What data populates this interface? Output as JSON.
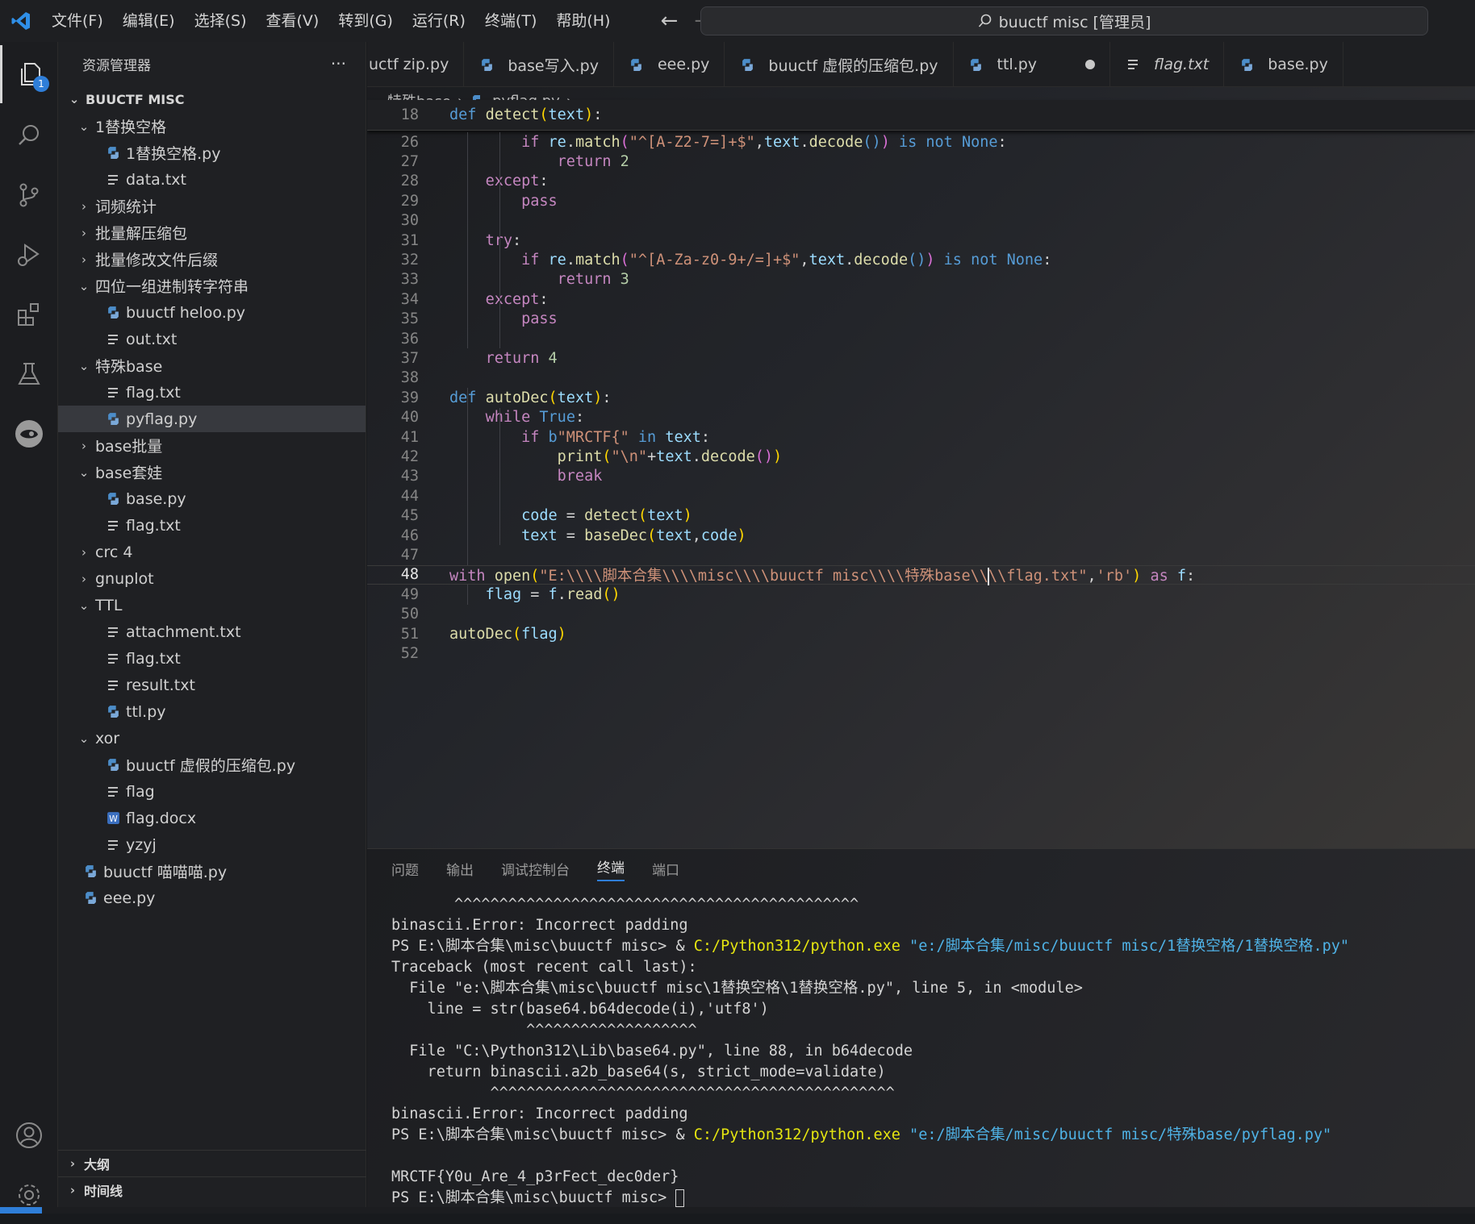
{
  "menu": [
    "文件(F)",
    "编辑(E)",
    "选择(S)",
    "查看(V)",
    "转到(G)",
    "运行(R)",
    "终端(T)",
    "帮助(H)"
  ],
  "nav": {
    "back": "←",
    "forward": "→"
  },
  "command_center": "buuctf misc [管理员]",
  "activity": {
    "explorer_badge": "1"
  },
  "sidebar": {
    "title": "资源管理器",
    "more": "···",
    "root": "BUUCTF MISC",
    "items": [
      {
        "label": "1替换空格",
        "type": "folder",
        "open": true,
        "depth": 1
      },
      {
        "label": "1替换空格.py",
        "type": "py",
        "depth": 2
      },
      {
        "label": "data.txt",
        "type": "txt",
        "depth": 2
      },
      {
        "label": "词频统计",
        "type": "folder",
        "open": false,
        "depth": 1
      },
      {
        "label": "批量解压缩包",
        "type": "folder",
        "open": false,
        "depth": 1
      },
      {
        "label": "批量修改文件后缀",
        "type": "folder",
        "open": false,
        "depth": 1
      },
      {
        "label": "四位一组进制转字符串",
        "type": "folder",
        "open": true,
        "depth": 1
      },
      {
        "label": "buuctf heloo.py",
        "type": "py",
        "depth": 2
      },
      {
        "label": "out.txt",
        "type": "txt",
        "depth": 2
      },
      {
        "label": "特殊base",
        "type": "folder",
        "open": true,
        "depth": 1
      },
      {
        "label": "flag.txt",
        "type": "txt",
        "depth": 2
      },
      {
        "label": "pyflag.py",
        "type": "py",
        "depth": 2,
        "selected": true
      },
      {
        "label": "base批量",
        "type": "folder",
        "open": false,
        "depth": 1
      },
      {
        "label": "base套娃",
        "type": "folder",
        "open": true,
        "depth": 1
      },
      {
        "label": "base.py",
        "type": "py",
        "depth": 2
      },
      {
        "label": "flag.txt",
        "type": "txt",
        "depth": 2
      },
      {
        "label": "crc 4",
        "type": "folder",
        "open": false,
        "depth": 1
      },
      {
        "label": "gnuplot",
        "type": "folder",
        "open": false,
        "depth": 1
      },
      {
        "label": "TTL",
        "type": "folder",
        "open": true,
        "depth": 1
      },
      {
        "label": "attachment.txt",
        "type": "txt",
        "depth": 2
      },
      {
        "label": "flag.txt",
        "type": "txt",
        "depth": 2
      },
      {
        "label": "result.txt",
        "type": "txt",
        "depth": 2
      },
      {
        "label": "ttl.py",
        "type": "py",
        "depth": 2
      },
      {
        "label": "xor",
        "type": "folder",
        "open": true,
        "depth": 1
      },
      {
        "label": "buuctf 虚假的压缩包.py",
        "type": "py",
        "depth": 2
      },
      {
        "label": "flag",
        "type": "txt",
        "depth": 2
      },
      {
        "label": "flag.docx",
        "type": "docx",
        "depth": 2
      },
      {
        "label": "yzyj",
        "type": "txt",
        "depth": 2
      },
      {
        "label": "buuctf 喵喵喵.py",
        "type": "py",
        "depth": 1
      },
      {
        "label": "eee.py",
        "type": "py",
        "depth": 1
      }
    ],
    "outline": "大纲",
    "timeline": "时间线"
  },
  "tabs": [
    {
      "label": "uctf zip.py",
      "icon": ""
    },
    {
      "label": "base写入.py",
      "icon": "py"
    },
    {
      "label": "eee.py",
      "icon": "py"
    },
    {
      "label": "buuctf 虚假的压缩包.py",
      "icon": "py"
    },
    {
      "label": "ttl.py",
      "icon": "py",
      "dirty": true
    },
    {
      "label": "flag.txt",
      "icon": "txt",
      "italic": true
    },
    {
      "label": "base.py",
      "icon": "py"
    }
  ],
  "breadcrumb": {
    "folder": "特殊base",
    "file": "pyflag.py",
    "more": "..."
  },
  "code": {
    "current_line": "48",
    "sticky": {
      "n": "18",
      "html": "<span class='k'>def</span> <span class='fn'>detect</span><span class='pb'>(</span><span class='var'>text</span><span class='pb'>)</span>:"
    },
    "lines": [
      {
        "n": "26",
        "html": "        <span class='kc'>if</span> <span class='var'>re</span>.<span class='fn'>match</span><span class='pu'>(</span><span class='str'>\"^[A-Z2-7=]+$\"</span>,<span class='var'>text</span>.<span class='fn'>decode</span><span class='k'>()</span><span class='pu'>)</span> <span class='k'>is</span> <span class='k'>not</span> <span class='k'>None</span>:"
      },
      {
        "n": "27",
        "html": "            <span class='kc'>return</span> <span class='num'>2</span>"
      },
      {
        "n": "28",
        "html": "    <span class='kc'>except</span>:"
      },
      {
        "n": "29",
        "html": "        <span class='kc'>pass</span>"
      },
      {
        "n": "30",
        "html": ""
      },
      {
        "n": "31",
        "html": "    <span class='kc'>try</span>:"
      },
      {
        "n": "32",
        "html": "        <span class='kc'>if</span> <span class='var'>re</span>.<span class='fn'>match</span><span class='pu'>(</span><span class='str'>\"^[A-Za-z0-9+/=]+$\"</span>,<span class='var'>text</span>.<span class='fn'>decode</span><span class='k'>()</span><span class='pu'>)</span> <span class='k'>is</span> <span class='k'>not</span> <span class='k'>None</span>:"
      },
      {
        "n": "33",
        "html": "            <span class='kc'>return</span> <span class='num'>3</span>"
      },
      {
        "n": "34",
        "html": "    <span class='kc'>except</span>:"
      },
      {
        "n": "35",
        "html": "        <span class='kc'>pass</span>"
      },
      {
        "n": "36",
        "html": ""
      },
      {
        "n": "37",
        "html": "    <span class='kc'>return</span> <span class='num'>4</span>"
      },
      {
        "n": "38",
        "html": ""
      },
      {
        "n": "39",
        "html": "<span class='k'>def</span> <span class='fn'>autoDec</span><span class='pb'>(</span><span class='var'>text</span><span class='pb'>)</span>:"
      },
      {
        "n": "40",
        "html": "    <span class='kc'>while</span> <span class='k'>True</span>:"
      },
      {
        "n": "41",
        "html": "        <span class='kc'>if</span> <span class='k'>b</span><span class='str'>\"MRCTF{\"</span> <span class='k'>in</span> <span class='var'>text</span>:"
      },
      {
        "n": "42",
        "html": "            <span class='fn'>print</span><span class='pb'>(</span><span class='str'>\"\\n\"</span>+<span class='var'>text</span>.<span class='fn'>decode</span><span class='pu'>()</span><span class='pb'>)</span>"
      },
      {
        "n": "43",
        "html": "            <span class='kc'>break</span>"
      },
      {
        "n": "44",
        "html": ""
      },
      {
        "n": "45",
        "html": "        <span class='var'>code</span> = <span class='fn'>detect</span><span class='pb'>(</span><span class='var'>text</span><span class='pb'>)</span>"
      },
      {
        "n": "46",
        "html": "        <span class='var'>text</span> = <span class='fn'>baseDec</span><span class='pb'>(</span><span class='var'>text</span>,<span class='var'>code</span><span class='pb'>)</span>"
      },
      {
        "n": "47",
        "html": ""
      },
      {
        "n": "48",
        "html": "<span class='kc'>with</span> <span class='fn'>open</span><span class='pb'>(</span><span class='str'>\"E:\\\\\\\\脚本合集\\\\\\\\misc\\\\\\\\buuctf misc\\\\\\\\特殊base\\\\<span class='cursor'></span>\\\\flag.txt\"</span>,<span class='str'>'rb'</span><span class='pb'>)</span> <span class='kc'>as</span> <span class='var'>f</span>:"
      },
      {
        "n": "49",
        "html": "    <span class='var'>flag</span> = <span class='var'>f</span>.<span class='fn'>read</span><span class='pb'>()</span>"
      },
      {
        "n": "50",
        "html": ""
      },
      {
        "n": "51",
        "html": "<span class='fn'>autoDec</span><span class='pb'>(</span><span class='var'>flag</span><span class='pb'>)</span>"
      },
      {
        "n": "52",
        "html": ""
      }
    ]
  },
  "panel": {
    "tabs": [
      "问题",
      "输出",
      "调试控制台",
      "终端",
      "端口"
    ],
    "active_tab": "终端",
    "lines": [
      {
        "text": "       ^^^^^^^^^^^^^^^^^^^^^^^^^^^^^^^^^^^^^^^^^^^^^",
        "parts": []
      },
      {
        "text": "binascii.Error: Incorrect padding",
        "parts": []
      },
      {
        "text": "",
        "parts": [
          {
            "t": "PS E:\\脚本合集\\misc\\buuctf misc> & ",
            "c": ""
          },
          {
            "t": "C:/Python312/python.exe",
            "c": "t-yellow"
          },
          {
            "t": " \"e:/脚本合集/misc/buuctf misc/1替换空格/1替换空格.py\"",
            "c": "t-cyan"
          }
        ]
      },
      {
        "text": "Traceback (most recent call last):",
        "parts": []
      },
      {
        "text": "  File \"e:\\脚本合集\\misc\\buuctf misc\\1替换空格\\1替换空格.py\", line 5, in <module>",
        "parts": []
      },
      {
        "text": "    line = str(base64.b64decode(i),'utf8')",
        "parts": []
      },
      {
        "text": "               ^^^^^^^^^^^^^^^^^^^",
        "parts": []
      },
      {
        "text": "  File \"C:\\Python312\\Lib\\base64.py\", line 88, in b64decode",
        "parts": []
      },
      {
        "text": "    return binascii.a2b_base64(s, strict_mode=validate)",
        "parts": []
      },
      {
        "text": "           ^^^^^^^^^^^^^^^^^^^^^^^^^^^^^^^^^^^^^^^^^^^^^",
        "parts": []
      },
      {
        "text": "binascii.Error: Incorrect padding",
        "parts": []
      },
      {
        "text": "",
        "parts": [
          {
            "t": "PS E:\\脚本合集\\misc\\buuctf misc> & ",
            "c": ""
          },
          {
            "t": "C:/Python312/python.exe",
            "c": "t-yellow"
          },
          {
            "t": " \"e:/脚本合集/misc/buuctf misc/特殊base/pyflag.py\"",
            "c": "t-cyan"
          }
        ]
      },
      {
        "text": " ",
        "parts": []
      },
      {
        "text": "MRCTF{Y0u_Are_4_p3rFect_dec0der}",
        "parts": []
      },
      {
        "text": "PS E:\\脚本合集\\misc\\buuctf misc> ",
        "parts": [],
        "cursor": true
      }
    ]
  },
  "colors": {
    "accent": "#2f7ed8",
    "python_icon": "#4c8dc9"
  }
}
